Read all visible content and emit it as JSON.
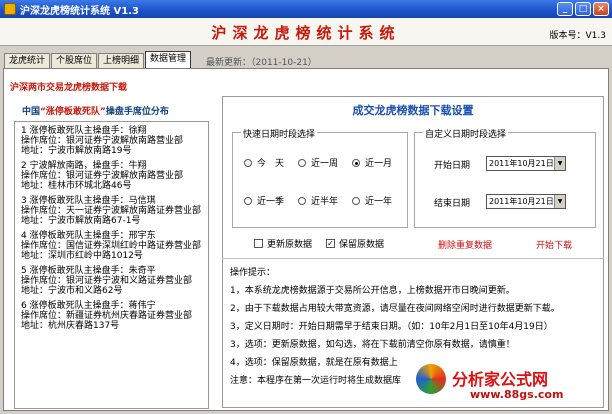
{
  "window": {
    "title": "沪深龙虎榜统计系统 V1.3"
  },
  "banner": {
    "title": "沪深龙虎榜统计系统",
    "version": "版本号：V1.3"
  },
  "tabs": [
    "龙虎统计",
    "个股席位",
    "上榜明细",
    "数据管理"
  ],
  "update": "最新更新：（2011-10-21）",
  "subtitle": "沪深两市交易龙虎榜数据下载",
  "left": {
    "heading_prefix": "中国",
    "heading_quote": "“涨停板敢死队”",
    "heading_suffix": "操盘手席位分布",
    "entries": [
      {
        "name": "1 涨停板敢死队主操盘手：徐翔",
        "dept": "操作席位：银河证券宁波解放南路营业部",
        "addr": "地址：宁波市解放南路19号"
      },
      {
        "name": "2 宁波解放南路，操盘手：牛翔",
        "dept": "操作席位：银河证券宁波解放南路营业部",
        "addr": "地址：桂林市环城北路46号"
      },
      {
        "name": "3 涨停板敢死队主操盘手：马信琪",
        "dept": "操作席位：天一证券宁波解放南路证券营业部",
        "addr": "地址：宁波市解放南路67-1号"
      },
      {
        "name": "4 涨停板敢死队主操盘手：邢宇东",
        "dept": "操作席位：国信证券深圳红岭中路证券营业部",
        "addr": "地址：深圳市红岭中路1012号"
      },
      {
        "name": "5 涨停板敢死队主操盘手：朱奇平",
        "dept": "操作席位：银河证券宁波和义路证券营业部",
        "addr": "地址：宁波市和义路62号"
      },
      {
        "name": "6 涨停板敢死队主操盘手：蒋伟宁",
        "dept": "操作席位：新疆证券杭州庆春路证券营业部",
        "addr": "地址：杭州庆春路137号"
      }
    ]
  },
  "right": {
    "title": "成交龙虎榜数据下载设置",
    "quick_label": "快速日期时段选择",
    "custom_label": "自定义日期时段选择",
    "radios": [
      {
        "label": "今　天",
        "selected": false
      },
      {
        "label": "近一周",
        "selected": false
      },
      {
        "label": "近一月",
        "selected": true
      },
      {
        "label": "近一季",
        "selected": false
      },
      {
        "label": "近半年",
        "selected": false
      },
      {
        "label": "近一年",
        "selected": false
      }
    ],
    "start_label": "开始日期",
    "start_value": "2011年10月21日",
    "end_label": "结束日期",
    "end_value": "2011年10月21日",
    "update_chk": "更新原数据",
    "keep_chk": "保留原数据",
    "update_checked": false,
    "keep_checked": true,
    "delete_btn": "删除重复数据",
    "start_btn": "开始下载",
    "tips_title": "操作提示：",
    "tips": [
      "1，本系统龙虎榜数据源于交易所公开信息，上榜数据开市日晚间更新。",
      "2，由于下载数据占用较大带宽资源，请尽量在夜间网络空闲时进行数据更新下载。",
      "3，定义日期时：开始日期需早于结束日期。（如：10年2月1日至10年4月19日）",
      "3，选项：更新原数据，如勾选，将在下载前清空你原有数据，请慎重！",
      "4，选项：保留原数据，就是在原有数据上",
      "注意：本程序在第一次运行时将生成数据库"
    ]
  },
  "watermark": {
    "text": "分析家公式网",
    "url": "www.88gs.com"
  }
}
